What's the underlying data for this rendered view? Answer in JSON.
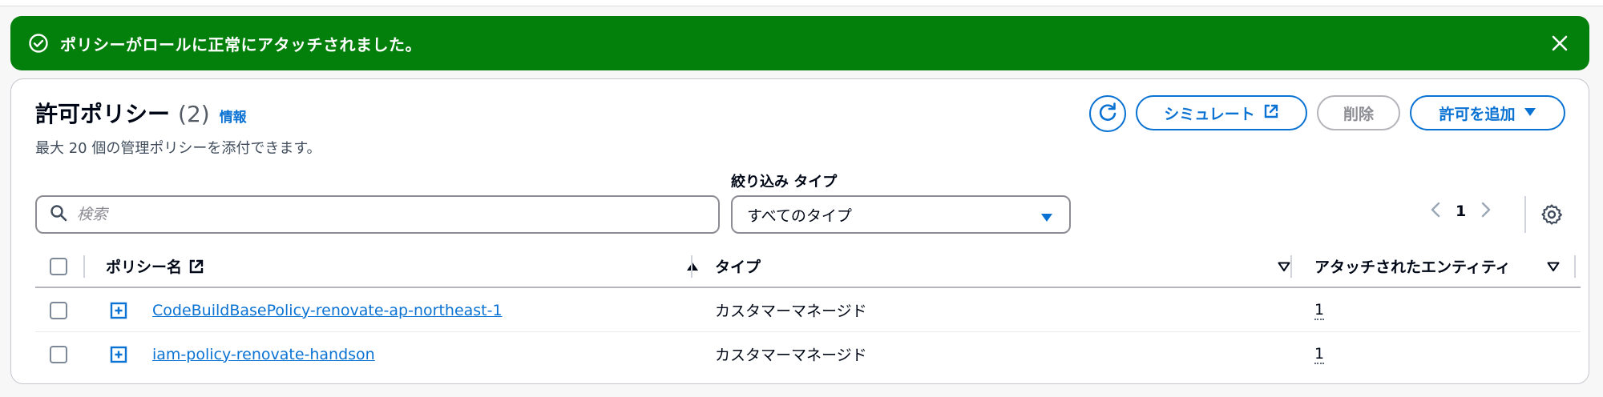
{
  "flash": {
    "message": "ポリシーがロールに正常にアタッチされました。",
    "bg_color": "#037f0c",
    "icons": [
      "check-circle-icon",
      "close-icon"
    ]
  },
  "header": {
    "title": "許可ポリシー",
    "count": "(2)",
    "info_link": "情報",
    "description": "最大 20 個の管理ポリシーを添付できます。"
  },
  "actions": {
    "refresh_icon": "refresh-icon",
    "simulate_label": "シミュレート",
    "delete_label": "削除",
    "add_label": "許可を追加"
  },
  "filter": {
    "search_placeholder": "検索",
    "type_label": "絞り込み タイプ",
    "type_selected": "すべてのタイプ"
  },
  "pagination": {
    "current_page": "1"
  },
  "table": {
    "columns": [
      "ポリシー名",
      "タイプ",
      "アタッチされたエンティティ"
    ],
    "rows": [
      {
        "name": "CodeBuildBasePolicy-renovate-ap-northeast-1",
        "type": "カスタマーマネージド",
        "attached": "1"
      },
      {
        "name": "iam-policy-renovate-handson",
        "type": "カスタマーマネージド",
        "attached": "1"
      }
    ]
  },
  "colors": {
    "accent": "#0972d3",
    "success": "#037f0c"
  }
}
